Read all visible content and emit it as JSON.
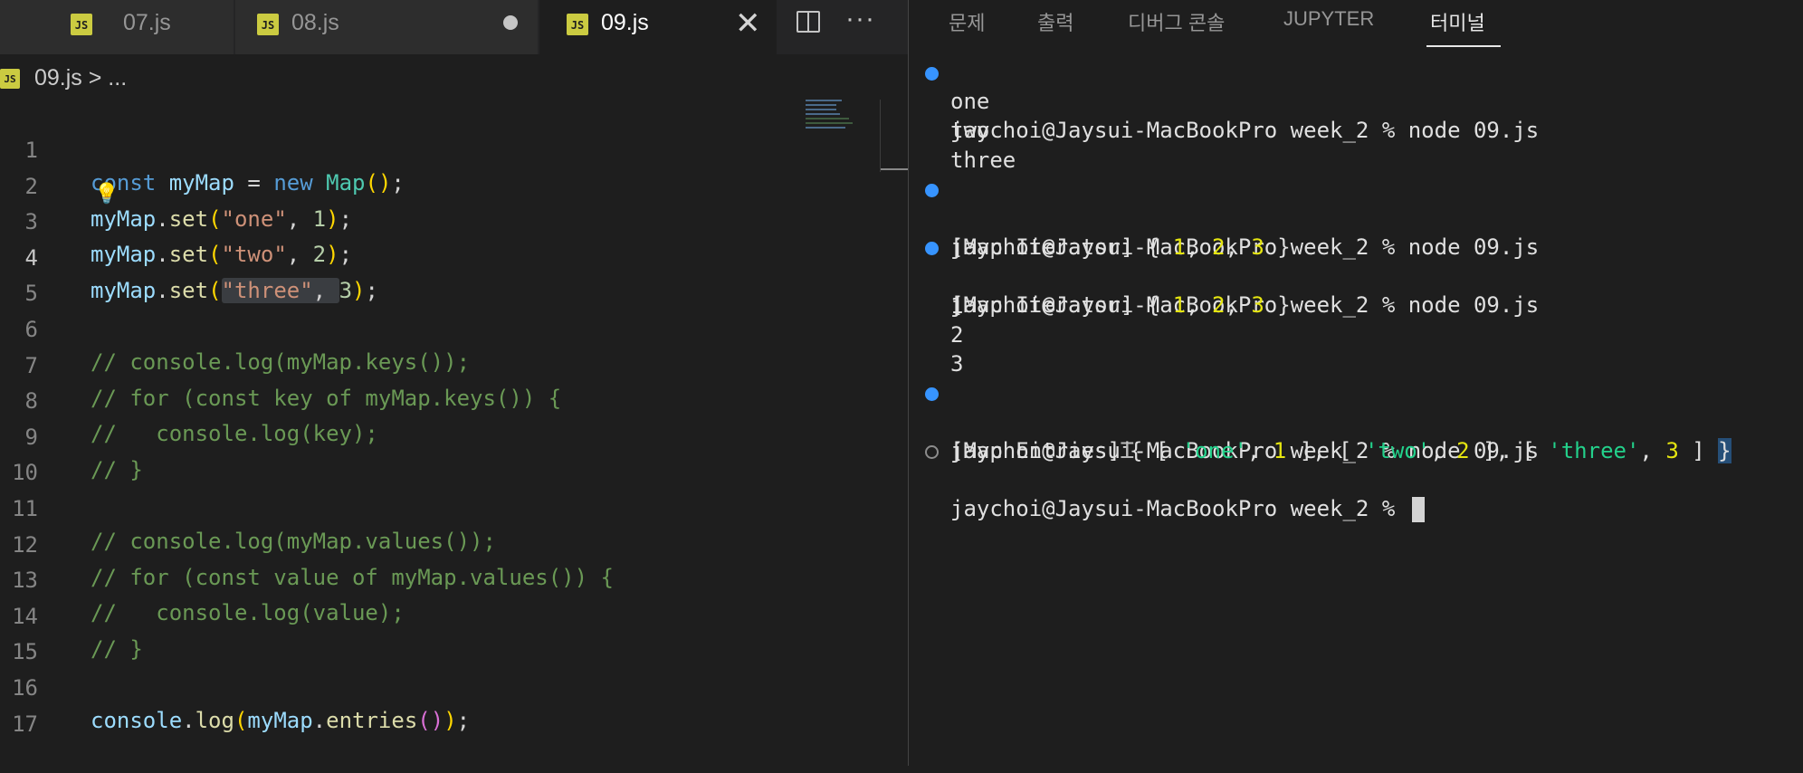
{
  "editor": {
    "tabs": [
      {
        "icon": "JS",
        "label": "07.js"
      },
      {
        "icon": "JS",
        "label": "08.js"
      },
      {
        "icon": "JS",
        "label": "09.js"
      }
    ],
    "close_glyph": "✕",
    "more_glyph": "···",
    "breadcrumb": {
      "icon": "JS",
      "file": "09.js",
      "rest": " > ..."
    },
    "line_numbers": [
      "1",
      "2",
      "3",
      "4",
      "5",
      "6",
      "7",
      "8",
      "9",
      "10",
      "11",
      "12",
      "13",
      "14",
      "15",
      "16",
      "17"
    ],
    "code": {
      "l1": {
        "const": "const",
        "name": "myMap",
        "eq": " = ",
        "new": "new",
        "cls": "Map",
        "open": "(",
        "close": ")",
        "semi": ";"
      },
      "l2": {
        "obj": "myMap",
        "dot": ".",
        "fn": "set",
        "open": "(",
        "key": "\"one\"",
        "comma": ", ",
        "val": "1",
        "close": ")",
        "semi": ";"
      },
      "l3": {
        "obj": "myMap",
        "dot": ".",
        "fn": "set",
        "open": "(",
        "key": "\"two\"",
        "comma": ", ",
        "val": "2",
        "close": ")",
        "semi": ";"
      },
      "l4": {
        "obj": "myMap",
        "dot": ".",
        "fn": "set",
        "open": "(",
        "key": "\"three\"",
        "comma": ", ",
        "val": "3",
        "close": ")",
        "semi": ";"
      },
      "l6": "// console.log(myMap.keys());",
      "l7": "// for (const key of myMap.keys()) {",
      "l8": "//   console.log(key);",
      "l9": "// }",
      "l11": "// console.log(myMap.values());",
      "l12": "// for (const value of myMap.values()) {",
      "l13": "//   console.log(value);",
      "l14": "// }",
      "l16": {
        "obj": "console",
        "dot": ".",
        "fn": "log",
        "open": "(",
        "arg": "myMap",
        "dot2": ".",
        "fn2": "entries",
        "open2": "(",
        "close2": ")",
        "close": ")",
        "semi": ";"
      }
    }
  },
  "panel": {
    "tabs": [
      "문제",
      "출력",
      "디버그 콘솔",
      "JUPYTER",
      "터미널"
    ],
    "active_tab": "터미널"
  },
  "terminal": {
    "prompt": "jaychoi@Jaysui-MacBookPro week_2 % ",
    "command": "node 09.js",
    "out_one": "one",
    "out_two": "two",
    "out_three": "three",
    "iter_prefix": "[Map Iterator] { ",
    "n1": "1",
    "n2": "2",
    "n3": "3",
    "comma": ", ",
    "iter_suffix": " }",
    "entries_prefix": "[Map Entries]",
    "ibeam": "Ꮖ",
    "entries_open": "{ [ ",
    "e_one": "'one'",
    "e_two": "'two'",
    "e_three": "'three'",
    "sep1": ", ",
    "sep2": " ], [ ",
    "sep3": " ] ",
    "entries_close": "}"
  }
}
